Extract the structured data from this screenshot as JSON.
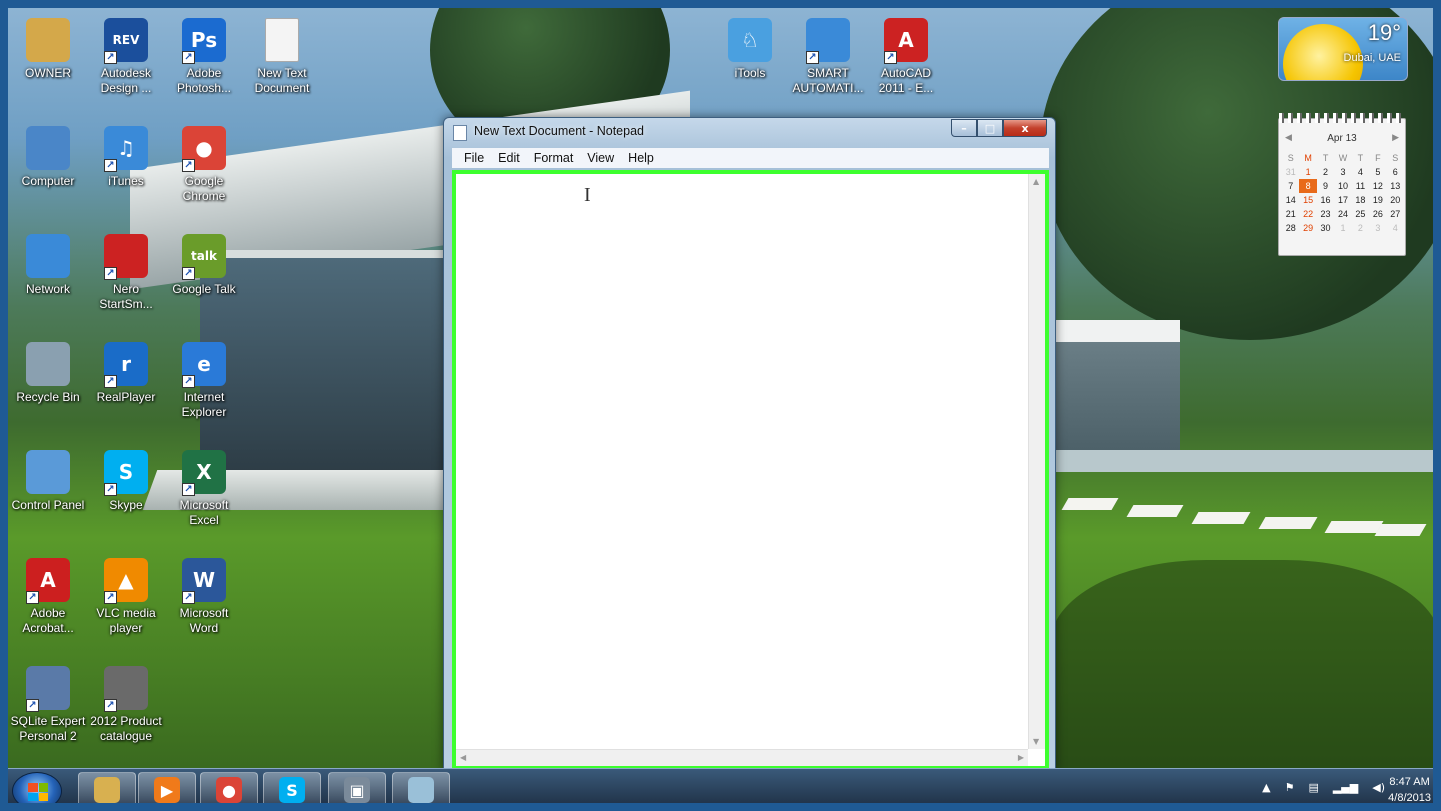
{
  "desktop_icons": [
    {
      "label": "OWNER",
      "icon": "user-folder-icon",
      "color": "#d4a84a",
      "glyph": ""
    },
    {
      "label": "Autodesk Design ...",
      "icon": "autodesk-revit-icon",
      "color": "#1b4f9c",
      "glyph": "REV"
    },
    {
      "label": "Adobe Photosh...",
      "icon": "photoshop-icon",
      "color": "#1b6bd0",
      "glyph": "Ps"
    },
    {
      "label": "New Text Document",
      "icon": "text-document-icon",
      "color": "#f4f4f4",
      "glyph": ""
    },
    {
      "label": "Computer",
      "icon": "computer-icon",
      "color": "#4a86c8",
      "glyph": ""
    },
    {
      "label": "iTunes",
      "icon": "itunes-icon",
      "color": "#3a8ad8",
      "glyph": "♫"
    },
    {
      "label": "Google Chrome",
      "icon": "chrome-icon",
      "color": "#db4437",
      "glyph": "●"
    },
    {
      "label": "Network",
      "icon": "network-icon",
      "color": "#3a8ad8",
      "glyph": ""
    },
    {
      "label": "Nero StartSm...",
      "icon": "nero-icon",
      "color": "#cc2222",
      "glyph": ""
    },
    {
      "label": "Google Talk",
      "icon": "google-talk-icon",
      "color": "#6a9c2a",
      "glyph": "talk"
    },
    {
      "label": "Recycle Bin",
      "icon": "recycle-bin-icon",
      "color": "#8aa0b0",
      "glyph": ""
    },
    {
      "label": "RealPlayer",
      "icon": "realplayer-icon",
      "color": "#1a6cc8",
      "glyph": "r"
    },
    {
      "label": "Internet Explorer",
      "icon": "internet-explorer-icon",
      "color": "#2a7ad8",
      "glyph": "e"
    },
    {
      "label": "Control Panel",
      "icon": "control-panel-icon",
      "color": "#5a9ad8",
      "glyph": ""
    },
    {
      "label": "Skype",
      "icon": "skype-icon",
      "color": "#00aff0",
      "glyph": "S"
    },
    {
      "label": "Microsoft Excel",
      "icon": "excel-icon",
      "color": "#207245",
      "glyph": "X"
    },
    {
      "label": "Adobe Acrobat...",
      "icon": "acrobat-icon",
      "color": "#cc1f1f",
      "glyph": "A"
    },
    {
      "label": "VLC media player",
      "icon": "vlc-icon",
      "color": "#f08a00",
      "glyph": "▲"
    },
    {
      "label": "Microsoft Word",
      "icon": "word-icon",
      "color": "#2b579a",
      "glyph": "W"
    },
    {
      "label": "SQLite Expert Personal 2",
      "icon": "sqlite-icon",
      "color": "#5a7aa8",
      "glyph": ""
    },
    {
      "label": "2012 Product catalogue",
      "icon": "pdf-document-icon",
      "color": "#6a6a6a",
      "glyph": ""
    },
    {
      "label": "iTools",
      "icon": "itools-icon",
      "color": "#4aa0e0",
      "glyph": "♘"
    },
    {
      "label": "SMART AUTOMATI...",
      "icon": "smart-home-icon",
      "color": "#3a8ad8",
      "glyph": ""
    },
    {
      "label": "AutoCAD 2011 - E...",
      "icon": "autocad-icon",
      "color": "#cc2222",
      "glyph": "A"
    }
  ],
  "notepad": {
    "title": "New Text Document - Notepad",
    "menu": [
      "File",
      "Edit",
      "Format",
      "View",
      "Help"
    ],
    "content": "",
    "minimize": "–",
    "maximize": "□",
    "close": "x"
  },
  "weather": {
    "temp": "19°",
    "city": "Dubai, UAE"
  },
  "calendar": {
    "month": "Apr 13",
    "weekdays": [
      "S",
      "M",
      "T",
      "W",
      "T",
      "F",
      "S"
    ],
    "days": [
      "31",
      "1",
      "2",
      "3",
      "4",
      "5",
      "6",
      "7",
      "8",
      "9",
      "10",
      "11",
      "12",
      "13",
      "14",
      "15",
      "16",
      "17",
      "18",
      "19",
      "20",
      "21",
      "22",
      "23",
      "24",
      "25",
      "26",
      "27",
      "28",
      "29",
      "30",
      "1",
      "2",
      "3",
      "4"
    ],
    "today": "8"
  },
  "taskbar": {
    "time": "8:47 AM",
    "date": "4/8/2013",
    "buttons": [
      {
        "name": "explorer",
        "icon": "folder-icon",
        "color": "#d8b050",
        "glyph": ""
      },
      {
        "name": "media-player",
        "icon": "media-player-icon",
        "color": "#f07a1a",
        "glyph": "▶"
      },
      {
        "name": "chrome",
        "icon": "chrome-icon",
        "color": "#db4437",
        "glyph": "●"
      },
      {
        "name": "skype",
        "icon": "skype-icon",
        "color": "#00aff0",
        "glyph": "S"
      },
      {
        "name": "remote",
        "icon": "remote-desktop-icon",
        "color": "#7a8a9a",
        "glyph": "▣"
      },
      {
        "name": "notepad",
        "icon": "notepad-icon",
        "color": "#9ac0d8",
        "glyph": ""
      }
    ]
  }
}
